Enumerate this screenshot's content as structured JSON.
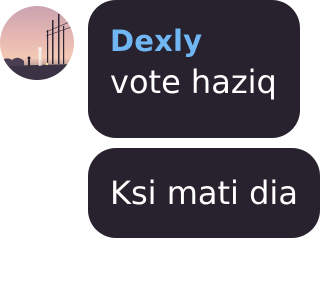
{
  "avatar": {
    "icon": "user-avatar-photo"
  },
  "messages": [
    {
      "sender": "Dexly",
      "text": "vote haziq"
    },
    {
      "text": "Ksi mati dia"
    }
  ],
  "colors": {
    "bubble": "#28222f",
    "sender_name": "#6fb6f2",
    "message_text": "#ffffff",
    "background": "#ffffff"
  }
}
